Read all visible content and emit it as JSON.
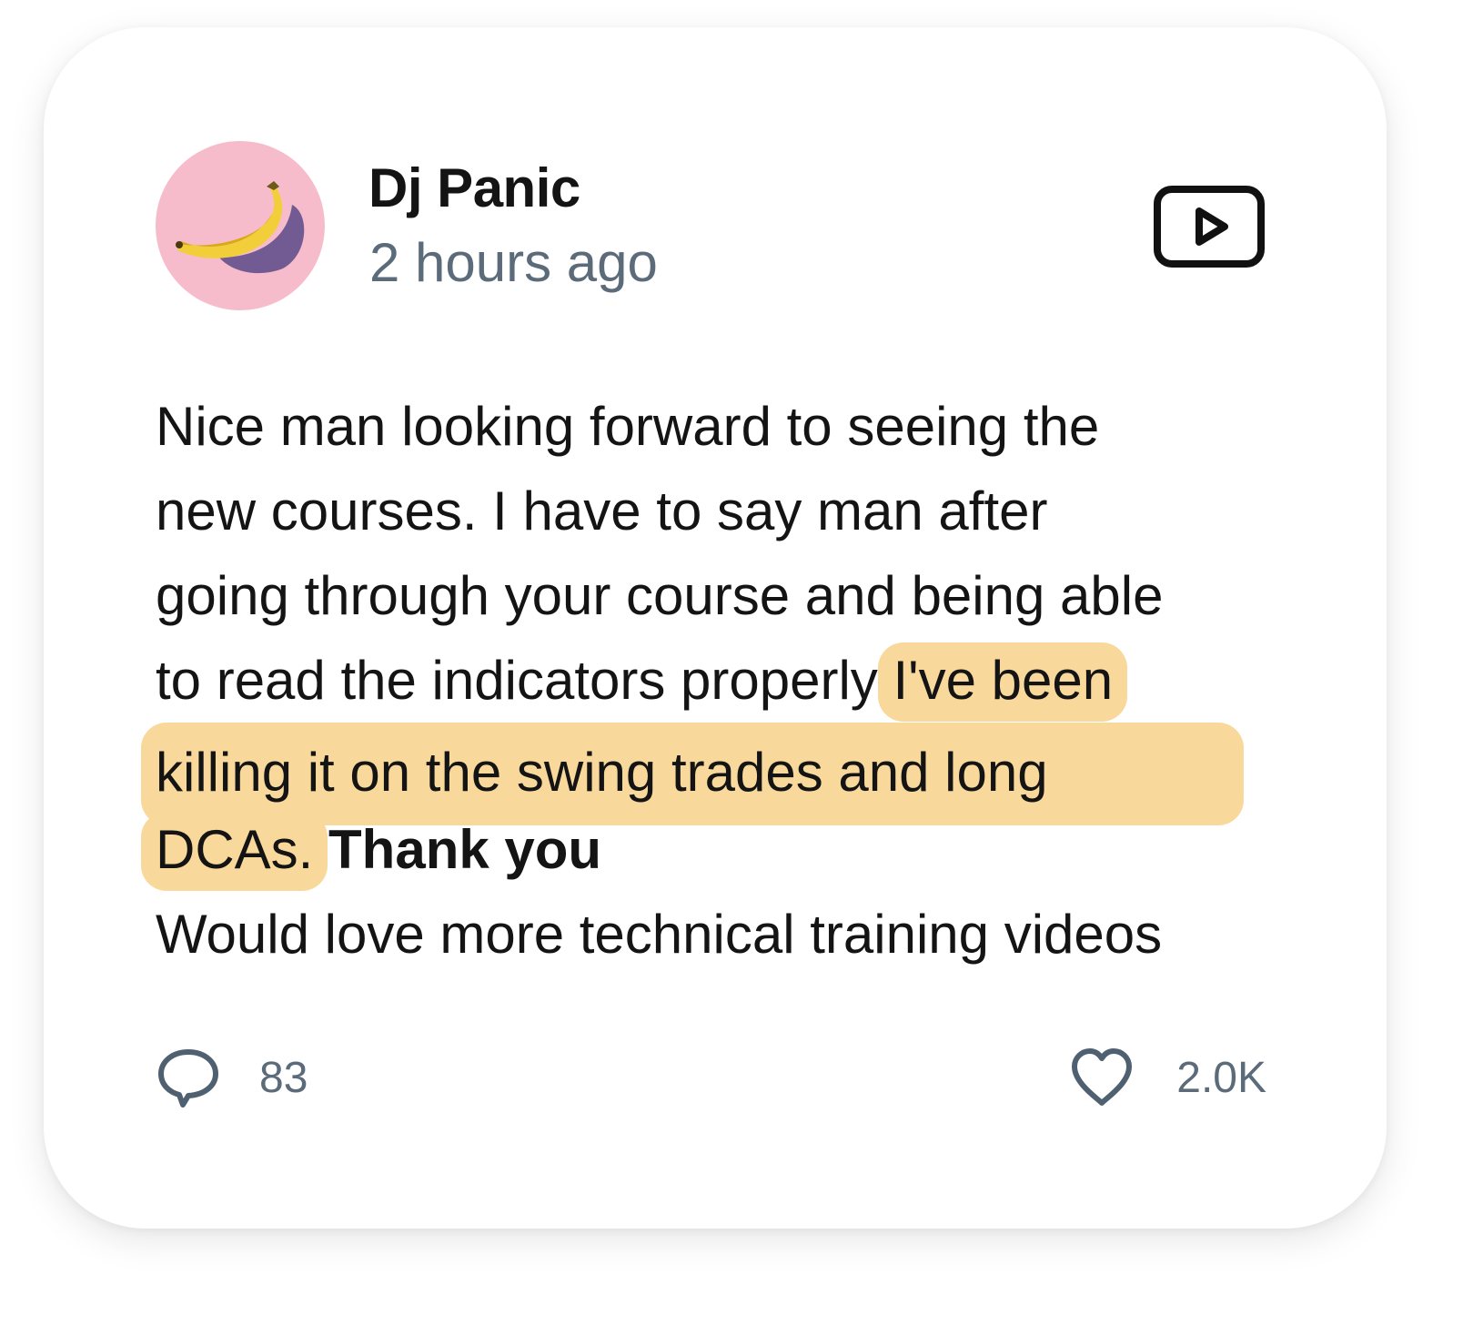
{
  "post": {
    "author": "Dj Panic",
    "timestamp": "2 hours ago",
    "avatar_icon": "banana-avatar",
    "video_icon": "video-play-icon",
    "body": {
      "line1": "Nice man looking forward to seeing the",
      "line2": "new courses. I have to say man after",
      "line3": "going through your course and being able",
      "line4_plain": "to read the indicators properly ",
      "line4_highlight": "I've been",
      "line5_highlight": "killing it on the swing trades and long",
      "line6_highlight": "DCAs.",
      "line6_bold": "Thank you",
      "line7": "Would love more technical training videos"
    },
    "comments_count": "83",
    "likes_count": "2.0K"
  },
  "colors": {
    "avatar_bg": "#f7bccb",
    "highlight": "#f9d99b",
    "muted_text": "#5b6b79",
    "text": "#141414"
  }
}
